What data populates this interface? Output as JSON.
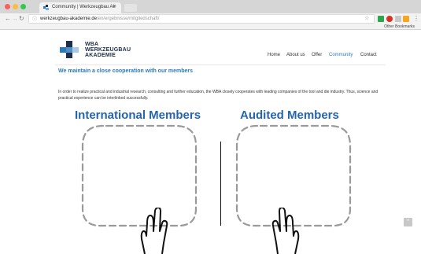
{
  "browser": {
    "tab_title": "Community | Werkzeugbau Ak",
    "tab_close": "×",
    "url_domain": "werkzeugbau-akademie.de",
    "url_path": "/en/ergebnisse/mitgliedschaft/",
    "other_bookmarks": "Other Bookmarks",
    "colors": {
      "close": "#fc605c",
      "minimize": "#fdbc40",
      "maximize": "#34c84a"
    }
  },
  "site": {
    "logo_lines": [
      "WBA",
      "WERKZEUGBAU",
      "AKADEMIE"
    ],
    "nav": [
      "Home",
      "About us",
      "Offer",
      "Community",
      "Contact"
    ],
    "active_nav": "Community",
    "accent": "#2a7ab9",
    "heading": "We maintain a close cooperation with our members",
    "paragraph": "In order to realize practical and industrial research, consulting and further education, the WBA closely cooperates with leading companies of the tool and die industry. Thus, science and practical experience can be interlinked successfully.",
    "columns": {
      "left_title": "International Members",
      "right_title": "Audited Members"
    }
  },
  "icons": [
    "back-icon",
    "forward-icon",
    "reload-icon",
    "lock-icon",
    "star-icon",
    "scroll-top-icon",
    "hand-cursor-icon"
  ]
}
